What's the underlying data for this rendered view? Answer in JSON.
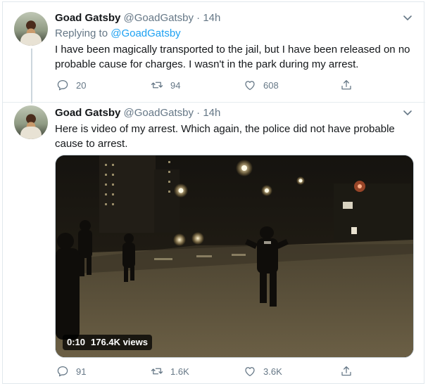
{
  "tweets": [
    {
      "name": "Goad Gatsby",
      "handle": "@GoadGatsby",
      "separator": "·",
      "time": "14h",
      "reply_prefix": "Replying to",
      "reply_mention": "@GoadGatsby",
      "text": "I have been magically transported to the jail, but I have been released on no probable cause for charges. I wasn't in the park during my arrest.",
      "replies": "20",
      "retweets": "94",
      "likes": "608"
    },
    {
      "name": "Goad Gatsby",
      "handle": "@GoadGatsby",
      "separator": "·",
      "time": "14h",
      "text": "Here is video of my arrest. Which again, the police did not have probable cause to arrest.",
      "video": {
        "duration": "0:10",
        "views": "176.4K views"
      },
      "replies": "91",
      "retweets": "1.6K",
      "likes": "3.6K"
    }
  ],
  "icons": {
    "more": "chevron-down-icon",
    "reply": "reply-icon",
    "retweet": "retweet-icon",
    "like": "heart-icon",
    "share": "share-icon"
  },
  "colors": {
    "link": "#1da1f2",
    "muted": "#657786",
    "text": "#14171a"
  }
}
